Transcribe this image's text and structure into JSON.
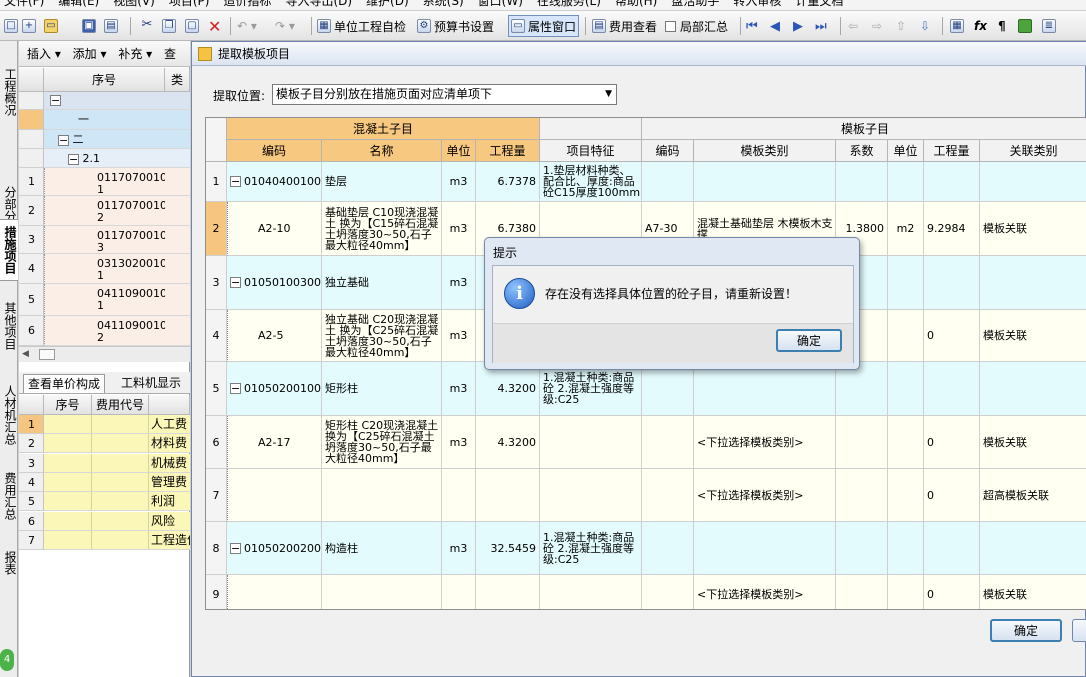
{
  "menubar": {
    "items": [
      "文件(F)",
      "编辑(E)",
      "视图(V)",
      "项目(P)",
      "造价指标",
      "导入导出(D)",
      "维护(D)",
      "系统(S)",
      "窗口(W)",
      "在线服务(L)",
      "帮助(H)",
      "盘活助手",
      "转入审核",
      "计量文档"
    ]
  },
  "toolbar": {
    "self_check": "单位工程自检",
    "budget_settings": "预算书设置",
    "property_window": "属性窗口",
    "fee_view": "费用查看",
    "partial_summary": "局部汇总"
  },
  "leftnav": {
    "tabs": [
      "工程概况",
      "分部分项",
      "措施项目",
      "其他项目",
      "人材机汇总",
      "费用汇总",
      "报表"
    ],
    "selected": 2
  },
  "leftpanel": {
    "subtoolbar": [
      "插入",
      "添加",
      "补充",
      "查"
    ],
    "header": {
      "seq": "序号",
      "type": "类"
    },
    "tree": [
      {
        "label": "",
        "rownum": ""
      },
      {
        "label": "一",
        "rownum": ""
      },
      {
        "label": "二",
        "rownum": ""
      },
      {
        "label": "2.1",
        "rownum": ""
      }
    ],
    "rows": [
      {
        "rownum": "1",
        "code": "01170700100",
        "suffix": "1"
      },
      {
        "rownum": "2",
        "code": "01170700100",
        "suffix": "2"
      },
      {
        "rownum": "3",
        "code": "01170700100",
        "suffix": "3"
      },
      {
        "rownum": "4",
        "code": "03130200100",
        "suffix": "1"
      },
      {
        "rownum": "5",
        "code": "04110900100",
        "suffix": "1"
      },
      {
        "rownum": "6",
        "code": "04110900100",
        "suffix": "2"
      }
    ],
    "bottom_tabs": [
      "查看单价构成",
      "工料机显示"
    ],
    "cost_header": {
      "seq": "序号",
      "code": "费用代号"
    },
    "cost_rows": [
      {
        "n": "1",
        "name": "人工费"
      },
      {
        "n": "2",
        "name": "材料费"
      },
      {
        "n": "3",
        "name": "机械费"
      },
      {
        "n": "4",
        "name": "管理费"
      },
      {
        "n": "5",
        "name": "利润"
      },
      {
        "n": "6",
        "name": "风险"
      },
      {
        "n": "7",
        "name": "工程造价"
      }
    ]
  },
  "dialog": {
    "title": "提取模板项目",
    "position_label": "提取位置:",
    "position_value": "模板子目分别放在措施页面对应清单项下",
    "group_concrete": "混凝土子目",
    "group_template": "模板子目",
    "columns_left": [
      "编码",
      "名称",
      "单位",
      "工程量",
      "项目特征"
    ],
    "columns_right": [
      "编码",
      "模板类别",
      "系数",
      "单位",
      "工程量",
      "关联类别"
    ],
    "rows": [
      {
        "n": "1",
        "code": "010404001001",
        "name": "垫层",
        "unit": "m3",
        "qty": "6.7378",
        "feature": "1.垫层材料种类、配合比、厚度:商品砼C15厚度100mm",
        "t_code": "",
        "t_type": "",
        "t_coef": "",
        "t_unit": "",
        "t_qty": "",
        "t_rel": ""
      },
      {
        "n": "2",
        "code": "A2-10",
        "name": "基础垫层 C10现浇混凝土 换为【C15碎石混凝土坍落度30~50,石子最大粒径40mm】",
        "unit": "m3",
        "qty": "6.7380",
        "feature": "",
        "t_code": "A7-30",
        "t_type": "混凝土基础垫层 木模板木支撑",
        "t_coef": "1.3800",
        "t_unit": "m2",
        "t_qty": "9.2984",
        "t_rel": "模板关联"
      },
      {
        "n": "3",
        "code": "010501003001",
        "name": "独立基础",
        "unit": "m3",
        "qty": "",
        "feature": "1.混凝土种类:商品砼",
        "t_code": "",
        "t_type": "",
        "t_coef": "",
        "t_unit": "",
        "t_qty": "",
        "t_rel": ""
      },
      {
        "n": "4",
        "code": "A2-5",
        "name": "独立基础 C20现浇混凝土 换为【C25碎石混凝土坍落度30~50,石子最大粒径40mm】",
        "unit": "m3",
        "qty": "",
        "feature": "",
        "t_code": "",
        "t_type": "",
        "t_coef": "",
        "t_unit": "",
        "t_qty": "0",
        "t_rel": "模板关联"
      },
      {
        "n": "5",
        "code": "010502001001",
        "name": "矩形柱",
        "unit": "m3",
        "qty": "4.3200",
        "feature": "1.混凝土种类:商品砼 2.混凝土强度等级:C25",
        "t_code": "",
        "t_type": "",
        "t_coef": "",
        "t_unit": "",
        "t_qty": "",
        "t_rel": ""
      },
      {
        "n": "6",
        "code": "A2-17",
        "name": "矩形柱 C20现浇混凝土 换为【C25碎石混凝土坍落度30~50,石子最大粒径40mm】",
        "unit": "m3",
        "qty": "4.3200",
        "feature": "",
        "t_code": "",
        "t_type": "<下拉选择模板类别>",
        "t_coef": "",
        "t_unit": "",
        "t_qty": "0",
        "t_rel": "模板关联"
      },
      {
        "n": "7",
        "code": "",
        "name": "",
        "unit": "",
        "qty": "",
        "feature": "",
        "t_code": "",
        "t_type": "<下拉选择模板类别>",
        "t_coef": "",
        "t_unit": "",
        "t_qty": "0",
        "t_rel": "超高模板关联"
      },
      {
        "n": "8",
        "code": "010502002001",
        "name": "构造柱",
        "unit": "m3",
        "qty": "32.5459",
        "feature": "1.混凝土种类:商品砼 2.混凝土强度等级:C25",
        "t_code": "",
        "t_type": "",
        "t_coef": "",
        "t_unit": "",
        "t_qty": "",
        "t_rel": ""
      },
      {
        "n": "9",
        "code": "",
        "name": "",
        "unit": "",
        "qty": "",
        "feature": "",
        "t_code": "",
        "t_type": "<下拉选择模板类别>",
        "t_coef": "",
        "t_unit": "",
        "t_qty": "0",
        "t_rel": "模板关联"
      }
    ],
    "ok_label": "确定"
  },
  "messagebox": {
    "title": "提示",
    "text": "存在没有选择具体位置的砼子目，请重新设置！",
    "ok_label": "确定"
  }
}
